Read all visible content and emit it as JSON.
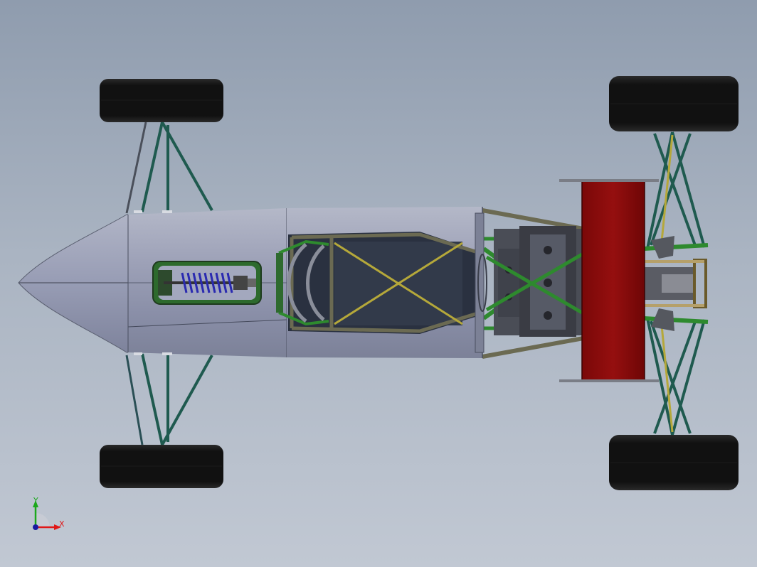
{
  "viewport": {
    "background_top": "#8f9cae",
    "background_bottom": "#c1c8d3"
  },
  "model": {
    "body_color": "#9aa0b8",
    "frame_color": "#2e8a2e",
    "suspension_color": "#1f5a4f",
    "wing_color": "#8b0c0c",
    "tire_color": "#141414",
    "spring_color": "#2a2ab0",
    "brace_color": "#b5a83a"
  },
  "triad": {
    "x_label": "X",
    "y_label": "Y",
    "x_color": "#e01818",
    "y_color": "#1ca81c",
    "z_color": "#1a1aa0"
  }
}
